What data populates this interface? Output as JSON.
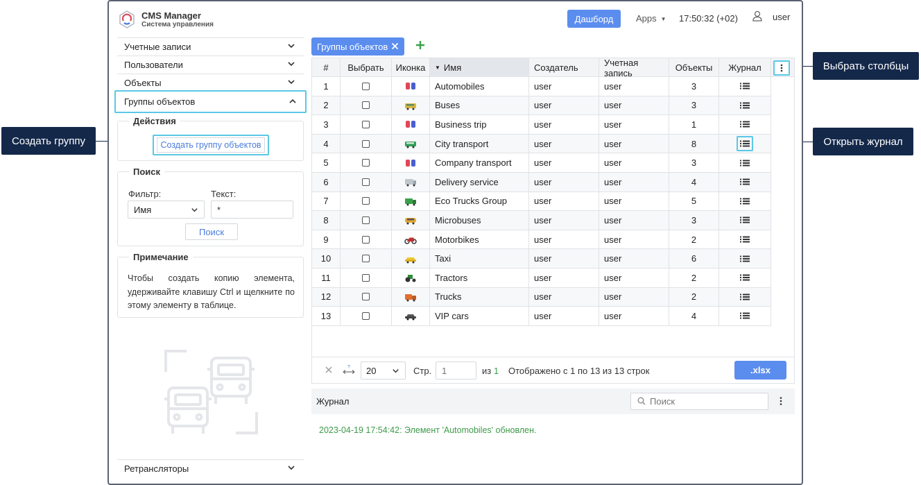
{
  "callouts": {
    "create_group": "Создать группу",
    "choose_columns": "Выбрать столбцы",
    "open_log": "Открыть журнал"
  },
  "header": {
    "title": "CMS Manager",
    "subtitle": "Система управления",
    "dashboard_label": "Дашборд",
    "apps_label": "Apps",
    "clock": "17:50:32 (+02)",
    "user": "user"
  },
  "sidebar": {
    "items": [
      {
        "label": "Учетные записи"
      },
      {
        "label": "Пользователи"
      },
      {
        "label": "Объекты"
      },
      {
        "label": "Группы объектов"
      }
    ],
    "actions_legend": "Действия",
    "create_button": "Создать группу объектов",
    "search_legend": "Поиск",
    "filter_label": "Фильтр:",
    "filter_value": "Имя",
    "text_label": "Текст:",
    "text_value": "*",
    "search_button": "Поиск",
    "note_legend": "Примечание",
    "note_text": "Чтобы создать копию элемента, удерживайте клавишу Ctrl и щелкните по этому элементу в таблице.",
    "retranslators": "Ретрансляторы"
  },
  "tab": {
    "label": "Группы объектов"
  },
  "table": {
    "columns": [
      "#",
      "Выбрать",
      "Иконка",
      "Имя",
      "Создатель",
      "Учетная запись",
      "Объекты",
      "Журнал"
    ],
    "rows": [
      {
        "n": "1",
        "name": "Automobiles",
        "creator": "user",
        "account": "user",
        "objects": "3",
        "icon": "car-pair-icon"
      },
      {
        "n": "2",
        "name": "Buses",
        "creator": "user",
        "account": "user",
        "objects": "3",
        "icon": "bus-icon"
      },
      {
        "n": "3",
        "name": "Business trip",
        "creator": "user",
        "account": "user",
        "objects": "1",
        "icon": "car-pair-icon"
      },
      {
        "n": "4",
        "name": "City transport",
        "creator": "user",
        "account": "user",
        "objects": "8",
        "icon": "tram-icon"
      },
      {
        "n": "5",
        "name": "Company transport",
        "creator": "user",
        "account": "user",
        "objects": "3",
        "icon": "car-pair-icon"
      },
      {
        "n": "6",
        "name": "Delivery service",
        "creator": "user",
        "account": "user",
        "objects": "4",
        "icon": "van-icon"
      },
      {
        "n": "7",
        "name": "Eco Trucks Group",
        "creator": "user",
        "account": "user",
        "objects": "5",
        "icon": "eco-truck-icon"
      },
      {
        "n": "8",
        "name": "Microbuses",
        "creator": "user",
        "account": "user",
        "objects": "3",
        "icon": "microbus-icon"
      },
      {
        "n": "9",
        "name": "Motorbikes",
        "creator": "user",
        "account": "user",
        "objects": "2",
        "icon": "motorbike-icon"
      },
      {
        "n": "10",
        "name": "Taxi",
        "creator": "user",
        "account": "user",
        "objects": "6",
        "icon": "taxi-icon"
      },
      {
        "n": "11",
        "name": "Tractors",
        "creator": "user",
        "account": "user",
        "objects": "2",
        "icon": "tractor-icon"
      },
      {
        "n": "12",
        "name": "Trucks",
        "creator": "user",
        "account": "user",
        "objects": "2",
        "icon": "truck-icon"
      },
      {
        "n": "13",
        "name": "VIP cars",
        "creator": "user",
        "account": "user",
        "objects": "4",
        "icon": "vip-car-icon"
      }
    ]
  },
  "footer": {
    "page_size": "20",
    "page_label": "Стр.",
    "page_value": "1",
    "of_label": "из",
    "total_pages": "1",
    "shown": "Отображено с 1 по 13 из 13 строк",
    "export_label": ".xlsx"
  },
  "log": {
    "title": "Журнал",
    "search_placeholder": "Поиск",
    "entry": "2023-04-19 17:54:42: Элемент 'Automobiles' обновлен."
  },
  "colors": {
    "accent": "#5b8def",
    "highlight": "#5ac8e6",
    "callout_bg": "#14284a",
    "log_text": "#3e9a4a"
  }
}
